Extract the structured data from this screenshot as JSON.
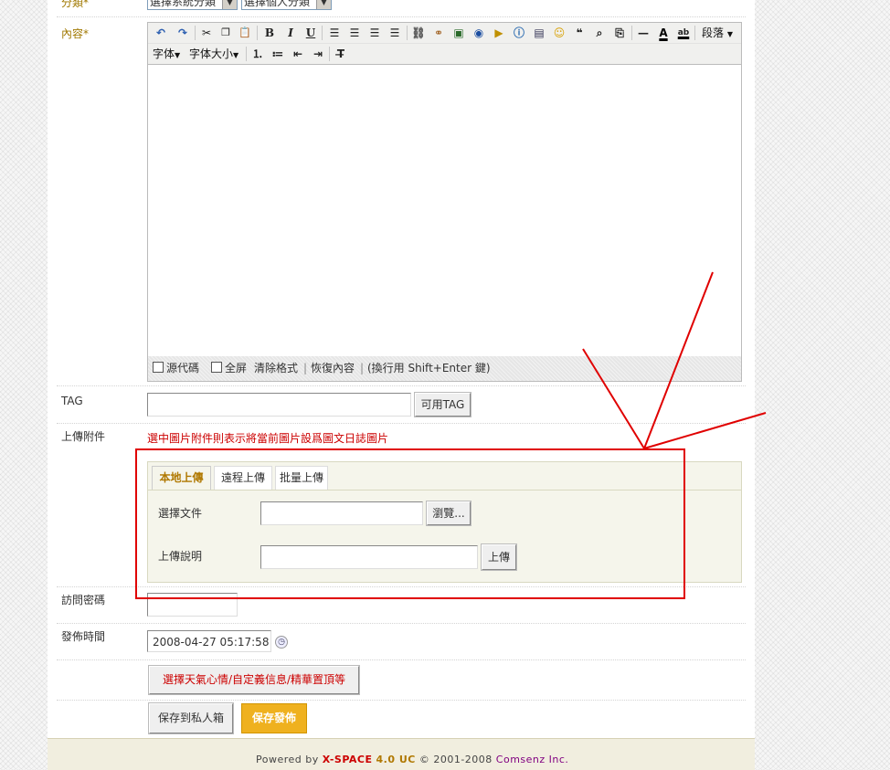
{
  "form": {
    "category_label": "分類*",
    "system_category_value": "選擇系統分類",
    "personal_category_value": "選擇個人分類",
    "content_label": "內容*",
    "tag_label": "TAG",
    "tag_value": "",
    "tag_button": "可用TAG",
    "attachment_label": "上傳附件",
    "attachment_hint": "選中圖片附件則表示將當前圖片設爲圖文日誌圖片",
    "password_label": "訪問密碼",
    "publish_time_label": "發佈時間",
    "publish_time_value": "2008-04-27 05:17:58",
    "extra_button": "選擇天氣心情/自定義信息/精華置頂等",
    "save_private_button": "保存到私人箱",
    "save_publish_button": "保存發佈"
  },
  "editor": {
    "toolbar_row1": [
      "undo-icon",
      "redo-icon",
      "cut-icon",
      "copy-icon",
      "paste-icon",
      "bold-icon",
      "italic-icon",
      "underline-icon",
      "align-left-icon",
      "align-center-icon",
      "align-right-icon",
      "justify-icon",
      "link-icon",
      "unlink-icon",
      "image-icon",
      "flash-icon",
      "media-icon",
      "info-icon",
      "table-icon",
      "smiley-icon",
      "quote-icon",
      "find-icon",
      "replace-icon",
      "horizontal-rule-icon",
      "font-color-icon",
      "highlight-icon"
    ],
    "paragraph_dropdown": "段落",
    "font_dropdown": "字体",
    "font_size_dropdown": "字体大小",
    "source_code": "源代碼",
    "fullscreen": "全屏",
    "clear_format": "清除格式",
    "restore_content": "恢復內容",
    "line_break_hint": "(換行用 Shift+Enter 鍵)",
    "separator": "|"
  },
  "upload": {
    "tabs": [
      "本地上傳",
      "遠程上傳",
      "批量上傳"
    ],
    "active_tab": 0,
    "select_file_label": "選擇文件",
    "browse_button": "瀏覽...",
    "description_label": "上傳說明",
    "upload_button": "上傳"
  },
  "footer": {
    "powered_by": "Powered by",
    "brand": "X-SPACE",
    "version": "4.0 UC",
    "copyright": "© 2001-2008",
    "company": "Comsenz Inc."
  },
  "colors": {
    "annotation_red": "#e00000",
    "label_gold": "#a07800",
    "publish_button": "#efb11f",
    "hint_red": "#cc0000"
  }
}
